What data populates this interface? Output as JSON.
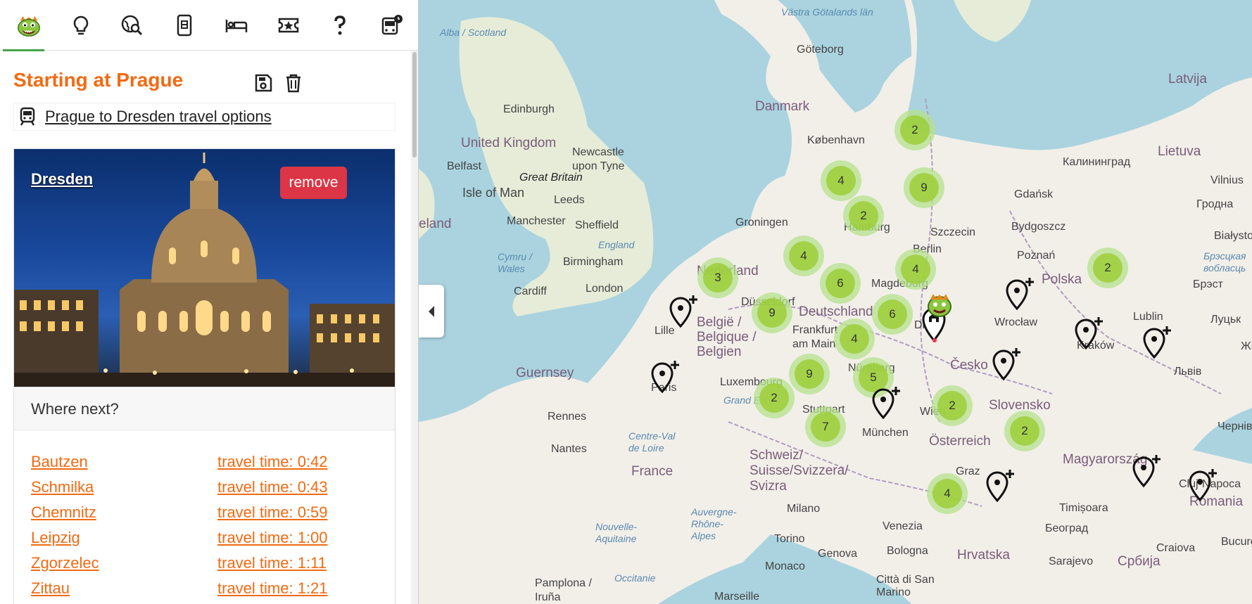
{
  "nav": {
    "items": [
      {
        "name": "logo-home",
        "icon": "monster-logo"
      },
      {
        "name": "ideas",
        "icon": "lightbulb-icon"
      },
      {
        "name": "explore",
        "icon": "globe-search-icon"
      },
      {
        "name": "tickets",
        "icon": "mobile-ticket-icon"
      },
      {
        "name": "hotels",
        "icon": "bed-icon"
      },
      {
        "name": "attractions",
        "icon": "star-ticket-icon"
      },
      {
        "name": "help",
        "icon": "question-icon"
      },
      {
        "name": "bus-schedule",
        "icon": "bus-clock-icon"
      }
    ]
  },
  "trip": {
    "title": "Starting at Prague",
    "travel_link": "Prague to Dresden travel options"
  },
  "card": {
    "city": "Dresden",
    "remove_label": "remove",
    "where_next": "Where next?",
    "destinations": [
      {
        "name": "Bautzen",
        "time": "travel time: 0:42"
      },
      {
        "name": "Schmilka",
        "time": "travel time: 0:43"
      },
      {
        "name": "Chemnitz",
        "time": "travel time: 0:59"
      },
      {
        "name": "Leipzig",
        "time": "travel time: 1:00"
      },
      {
        "name": "Zgorzelec",
        "time": "travel time: 1:11"
      },
      {
        "name": "Zittau",
        "time": "travel time: 1:21"
      }
    ]
  },
  "colors": {
    "accent": "#f26a12",
    "remove": "#dc3545",
    "active_tab": "#49a349",
    "water": "#aad3df",
    "land": "#f2efe9",
    "cluster": "#9acd32"
  },
  "map": {
    "labels": [
      {
        "text": "Västra Götalands län",
        "kind": "sea"
      },
      {
        "text": "Alba / Scotland",
        "kind": "sea"
      },
      {
        "text": "Göteborg",
        "kind": "city"
      },
      {
        "text": "Latvija",
        "kind": "country"
      },
      {
        "text": "Danmark",
        "kind": "country"
      },
      {
        "text": "Edinburgh",
        "kind": "city"
      },
      {
        "text": "København",
        "kind": "city"
      },
      {
        "text": "United Kingdom",
        "kind": "country"
      },
      {
        "text": "Newcastle upon Tyne",
        "kind": "city"
      },
      {
        "text": "Belfast",
        "kind": "city"
      },
      {
        "text": "Great Britain",
        "kind": "city"
      },
      {
        "text": "Lietuva",
        "kind": "country"
      },
      {
        "text": "Калининград",
        "kind": "city"
      },
      {
        "text": "Vilnius",
        "kind": "city"
      },
      {
        "text": "Isle of Man",
        "kind": "city"
      },
      {
        "text": "Leeds",
        "kind": "city"
      },
      {
        "text": "Gdańsk",
        "kind": "city"
      },
      {
        "text": "Hamburg",
        "kind": "city"
      },
      {
        "text": "Groningen",
        "kind": "city"
      },
      {
        "text": "Manchester",
        "kind": "city"
      },
      {
        "text": "Sheffield",
        "kind": "city"
      },
      {
        "text": "Szczecin",
        "kind": "city"
      },
      {
        "text": "Bydgoszcz",
        "kind": "city"
      },
      {
        "text": "Гродна",
        "kind": "city"
      },
      {
        "text": "eland",
        "kind": "country"
      },
      {
        "text": "England",
        "kind": "sea"
      },
      {
        "text": "Berlin",
        "kind": "city"
      },
      {
        "text": "Poznań",
        "kind": "city"
      },
      {
        "text": "Białystok",
        "kind": "city"
      },
      {
        "text": "Birmingham",
        "kind": "city"
      },
      {
        "text": "Nederland",
        "kind": "country"
      },
      {
        "text": "Polska",
        "kind": "country"
      },
      {
        "text": "Magdeburg",
        "kind": "city"
      },
      {
        "text": "Cardiff",
        "kind": "city"
      },
      {
        "text": "London",
        "kind": "city"
      },
      {
        "text": "Düsseldorf",
        "kind": "city"
      },
      {
        "text": "Deutschland",
        "kind": "country"
      },
      {
        "text": "Брэст",
        "kind": "city"
      },
      {
        "text": "Lille",
        "kind": "city"
      },
      {
        "text": "België / Belgique / Belgien",
        "kind": "country"
      },
      {
        "text": "Wrocław",
        "kind": "city"
      },
      {
        "text": "Lublin",
        "kind": "city"
      },
      {
        "text": "Луцьк",
        "kind": "city"
      },
      {
        "text": "Frankfurt am Main",
        "kind": "city"
      },
      {
        "text": "Kraków",
        "kind": "city"
      },
      {
        "text": "Česko",
        "kind": "country"
      },
      {
        "text": "Львів",
        "kind": "city"
      },
      {
        "text": "Guernsey",
        "kind": "country"
      },
      {
        "text": "Luxembourg",
        "kind": "city"
      },
      {
        "text": "Nürnberg",
        "kind": "city"
      },
      {
        "text": "Paris",
        "kind": "city"
      },
      {
        "text": "Rennes",
        "kind": "city"
      },
      {
        "text": "Stuttgart",
        "kind": "city"
      },
      {
        "text": "Wien",
        "kind": "city"
      },
      {
        "text": "Slovensko",
        "kind": "country"
      },
      {
        "text": "München",
        "kind": "city"
      },
      {
        "text": "Österreich",
        "kind": "country"
      },
      {
        "text": "Nantes",
        "kind": "city"
      },
      {
        "text": "Schweiz/ Suisse/Svizzera/ Svizra",
        "kind": "country"
      },
      {
        "text": "Magyarország",
        "kind": "country"
      },
      {
        "text": "France",
        "kind": "country"
      },
      {
        "text": "Graz",
        "kind": "city"
      },
      {
        "text": "Cluj-Napoca",
        "kind": "city"
      },
      {
        "text": "Romania",
        "kind": "country"
      },
      {
        "text": "Milano",
        "kind": "city"
      },
      {
        "text": "Timișoara",
        "kind": "city"
      },
      {
        "text": "Venezia",
        "kind": "city"
      },
      {
        "text": "Београд",
        "kind": "city"
      },
      {
        "text": "Torino",
        "kind": "city"
      },
      {
        "text": "Hrvatska",
        "kind": "country"
      },
      {
        "text": "Genova",
        "kind": "city"
      },
      {
        "text": "Bologna",
        "kind": "city"
      },
      {
        "text": "Craiova",
        "kind": "city"
      },
      {
        "text": "Monaco",
        "kind": "city"
      },
      {
        "text": "Sarajevo",
        "kind": "city"
      },
      {
        "text": "Србија",
        "kind": "country"
      },
      {
        "text": "Città di San Marino",
        "kind": "city"
      },
      {
        "text": "Pamplona / Iruña",
        "kind": "city"
      },
      {
        "text": "Marseille",
        "kind": "city"
      },
      {
        "text": "Occitanie",
        "kind": "sea"
      },
      {
        "text": "Nouvelle-Aquitaine",
        "kind": "sea"
      },
      {
        "text": "Auvergne-Rhône-Alpes",
        "kind": "sea"
      },
      {
        "text": "Centre-Val de Loire",
        "kind": "sea"
      },
      {
        "text": "Grand Est",
        "kind": "sea"
      },
      {
        "text": "Cymru / Wales",
        "kind": "sea"
      },
      {
        "text": "Bucures",
        "kind": "city"
      },
      {
        "text": "Чернівц",
        "kind": "city"
      },
      {
        "text": "Жи",
        "kind": "city"
      },
      {
        "text": "Vilnius",
        "kind": "city"
      },
      {
        "text": "Брэсцкая вобласць",
        "kind": "sea"
      },
      {
        "text": "Dres",
        "kind": "city"
      }
    ],
    "clusters": [
      "2",
      "4",
      "9",
      "2",
      "4",
      "4",
      "3",
      "6",
      "9",
      "6",
      "4",
      "9",
      "5",
      "2",
      "7",
      "2",
      "2",
      "4",
      "2"
    ]
  }
}
